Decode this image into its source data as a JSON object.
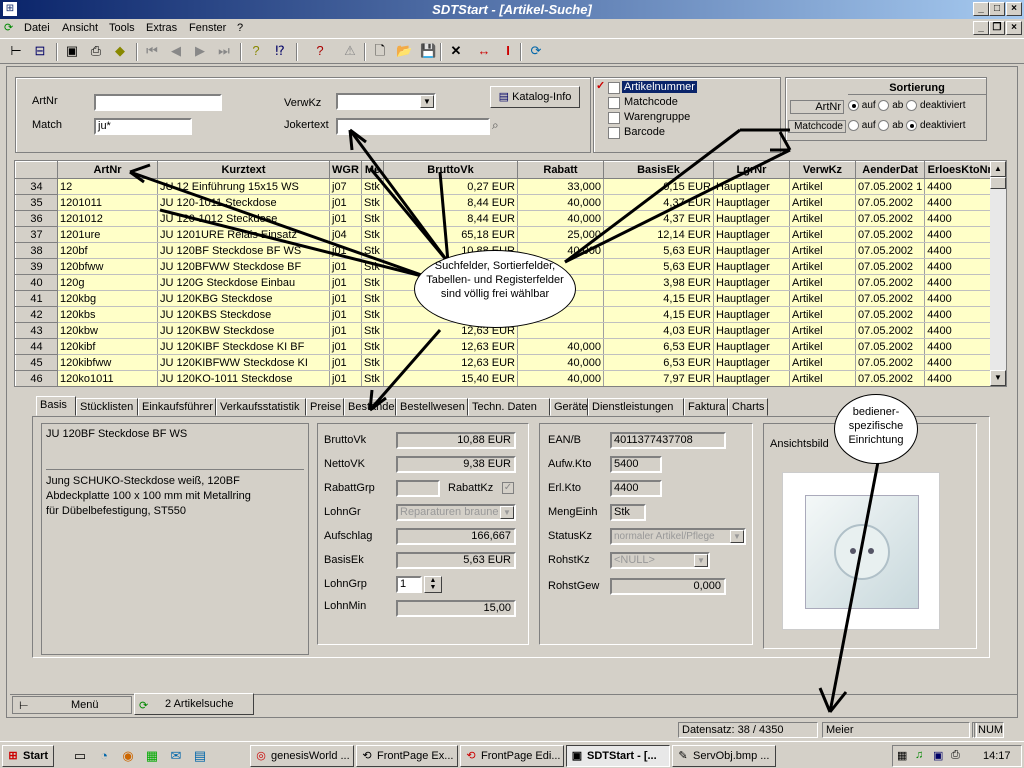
{
  "window": {
    "title": "SDTStart  - [Artikel-Suche]"
  },
  "menu": [
    "Datei",
    "Ansicht",
    "Tools",
    "Extras",
    "Fenster",
    "?"
  ],
  "search": {
    "artnr_label": "ArtNr",
    "artnr_value": "",
    "match_label": "Match",
    "match_value": "ju*",
    "verwkz_label": "VerwKz",
    "verwkz_value": "",
    "joker_label": "Jokertext",
    "joker_value": "",
    "katalog_button": "Katalog-Info"
  },
  "fields_list": {
    "items": [
      {
        "label": "Artikelnummer",
        "checked": true
      },
      {
        "label": "Matchcode",
        "checked": false
      },
      {
        "label": "Warengruppe",
        "checked": false
      },
      {
        "label": "Barcode",
        "checked": false
      }
    ]
  },
  "sort": {
    "title": "Sortierung",
    "rows": [
      {
        "label": "ArtNr",
        "opts": [
          "auf",
          "ab",
          "deaktiviert"
        ],
        "sel": 0
      },
      {
        "label": "Matchcode",
        "opts": [
          "auf",
          "ab",
          "deaktiviert"
        ],
        "sel": 2
      }
    ]
  },
  "grid": {
    "columns": [
      "",
      "ArtNr",
      "Kurztext",
      "WGR",
      "Me",
      "BruttoVk",
      "Rabatt",
      "BasisEk",
      "LgrNr",
      "VerwKz",
      "AenderDat",
      "ErloesKtoNr"
    ],
    "rows": [
      [
        "34",
        "12",
        "JU 12 Einführung 15x15 WS",
        "j07",
        "Stk",
        "0,27 EUR",
        "33,000",
        "0,15 EUR",
        "Hauptlager",
        "Artikel",
        "07.05.2002 1",
        "4400"
      ],
      [
        "35",
        "1201011",
        "JU 120-1011 Steckdose",
        "j01",
        "Stk",
        "8,44 EUR",
        "40,000",
        "4,37 EUR",
        "Hauptlager",
        "Artikel",
        "07.05.2002",
        "4400"
      ],
      [
        "36",
        "1201012",
        "JU 120-1012 Steckdose",
        "j01",
        "Stk",
        "8,44 EUR",
        "40,000",
        "4,37 EUR",
        "Hauptlager",
        "Artikel",
        "07.05.2002",
        "4400"
      ],
      [
        "37",
        "1201ure",
        "JU 1201URE Relais Einsatz",
        "j04",
        "Stk",
        "65,18 EUR",
        "25,000",
        "12,14 EUR",
        "Hauptlager",
        "Artikel",
        "07.05.2002",
        "4400"
      ],
      [
        "38",
        "120bf",
        "JU 120BF Steckdose BF WS",
        "j01",
        "Stk",
        "10,88 EUR",
        "40,000",
        "5,63 EUR",
        "Hauptlager",
        "Artikel",
        "07.05.2002",
        "4400"
      ],
      [
        "39",
        "120bfww",
        "JU 120BFWW Steckdose BF",
        "j01",
        "Stk",
        "",
        "",
        "5,63 EUR",
        "Hauptlager",
        "Artikel",
        "07.05.2002",
        "4400"
      ],
      [
        "40",
        "120g",
        "JU 120G Steckdose Einbau",
        "j01",
        "Stk",
        "",
        "",
        "3,98 EUR",
        "Hauptlager",
        "Artikel",
        "07.05.2002",
        "4400"
      ],
      [
        "41",
        "120kbg",
        "JU 120KBG Steckdose",
        "j01",
        "Stk",
        "",
        "",
        "4,15 EUR",
        "Hauptlager",
        "Artikel",
        "07.05.2002",
        "4400"
      ],
      [
        "42",
        "120kbs",
        "JU 120KBS Steckdose",
        "j01",
        "Stk",
        "",
        "",
        "4,15 EUR",
        "Hauptlager",
        "Artikel",
        "07.05.2002",
        "4400"
      ],
      [
        "43",
        "120kbw",
        "JU 120KBW Steckdose",
        "j01",
        "Stk",
        "12,63 EUR",
        "",
        "4,03 EUR",
        "Hauptlager",
        "Artikel",
        "07.05.2002",
        "4400"
      ],
      [
        "44",
        "120kibf",
        "JU 120KIBF Steckdose KI BF",
        "j01",
        "Stk",
        "12,63 EUR",
        "40,000",
        "6,53 EUR",
        "Hauptlager",
        "Artikel",
        "07.05.2002",
        "4400"
      ],
      [
        "45",
        "120kibfww",
        "JU 120KIBFWW Steckdose KI",
        "j01",
        "Stk",
        "12,63 EUR",
        "40,000",
        "6,53 EUR",
        "Hauptlager",
        "Artikel",
        "07.05.2002",
        "4400"
      ],
      [
        "46",
        "120ko1011",
        "JU 120KO-1011 Steckdose",
        "j01",
        "Stk",
        "15,40 EUR",
        "40,000",
        "7,97 EUR",
        "Hauptlager",
        "Artikel",
        "07.05.2002",
        "4400"
      ]
    ]
  },
  "tabs": [
    "Basis",
    "Stücklisten",
    "Einkaufsführer",
    "Verkaufsstatistik",
    "Preise",
    "Bestände",
    "Bestellwesen",
    "Techn. Daten",
    "Geräte",
    "Dienstleistungen",
    "Faktura",
    "Charts"
  ],
  "detail": {
    "kurztext": "JU 120BF Steckdose BF WS",
    "langtext": "Jung SCHUKO-Steckdose weiß, 120BF\nAbdeckplatte 100 x 100 mm mit Metallring\nfür Dübelbefestigung, ST550",
    "bruttovk_label": "BruttoVk",
    "bruttovk": "10,88 EUR",
    "nettovk_label": "NettoVK",
    "nettovk": "9,38 EUR",
    "rabattgrp_label": "RabattGrp",
    "rabattgrp": "",
    "rabattkz_label": "RabattKz",
    "lohngr_label": "LohnGr",
    "lohngr": "Reparaturen braune",
    "aufschlag_label": "Aufschlag",
    "aufschlag": "166,667",
    "basisek_label": "BasisEk",
    "basisek": "5,63 EUR",
    "lohngrp_label": "LohnGrp",
    "lohngrp": "1",
    "lohnmin_label": "LohnMin",
    "lohnmin": "15,00",
    "ean_label": "EAN/B",
    "ean": "4011377437708",
    "aufwkto_label": "Aufw.Kto",
    "aufwkto": "5400",
    "erlkto_label": "Erl.Kto",
    "erlkto": "4400",
    "mengeinh_label": "MengEinh",
    "mengeinh": "Stk",
    "statuskz_label": "StatusKz",
    "statuskz": "normaler Artikel/Pflege",
    "rohstkz_label": "RohstKz",
    "rohstkz": "<NULL>",
    "rohstgew_label": "RohstGew",
    "rohstgew": "0,000",
    "ansicht_label": "Ansichtsbild"
  },
  "callouts": {
    "c1": "Suchfelder, Sortierfelder, Tabellen- und Registerfelder sind völlig frei wählbar",
    "c2": "bediener-spezifische Einrichtung"
  },
  "docktabs": [
    {
      "label": "Menü"
    },
    {
      "label": "2 Artikelsuche"
    }
  ],
  "status": {
    "datensatz": "Datensatz: 38 / 4350",
    "user": "Meier",
    "num": "NUM"
  },
  "taskbar": {
    "start": "Start",
    "items": [
      "genesisWorld ...",
      "FrontPage Ex...",
      "FrontPage Edi...",
      "SDTStart - [...",
      "ServObj.bmp ..."
    ],
    "clock": "14:17"
  }
}
